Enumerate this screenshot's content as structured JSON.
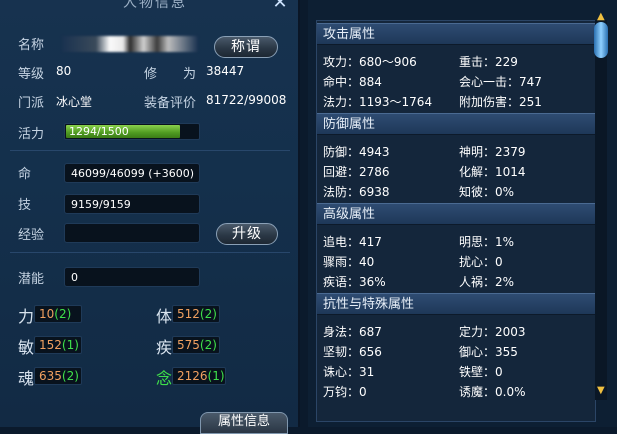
{
  "window": {
    "title": "人物信息",
    "close": "✕"
  },
  "profile": {
    "name_label": "名称",
    "title_button": "称谓",
    "level_label": "等级",
    "level_value": "80",
    "cultivation_label": "修　　为",
    "cultivation_value": "38447",
    "sect_label": "门派",
    "sect_value": "冰心堂",
    "rating_label": "装备评价",
    "rating_value": "81722/99008",
    "vitality_label": "活力",
    "vitality_value": "1294/1500",
    "vitality_fraction": 0.863,
    "life_label": "命",
    "life_value": "46099/46099 (+3600)",
    "skill_label": "技",
    "skill_value": "9159/9159",
    "exp_label": "经验",
    "exp_value": "",
    "upgrade_button": "升级",
    "potential_label": "潜能",
    "potential_value": "0"
  },
  "attributes": [
    {
      "label": "力",
      "base": "10",
      "plus": "(2)"
    },
    {
      "label": "体",
      "base": "512",
      "plus": "(2)"
    },
    {
      "label": "敏",
      "base": "152",
      "plus": "(1)"
    },
    {
      "label": "疾",
      "base": "575",
      "plus": "(2)"
    },
    {
      "label": "魂",
      "base": "635",
      "plus": "(2)"
    },
    {
      "label": "念",
      "base": "2126",
      "plus": "(1)"
    }
  ],
  "bottom_tab": "属性信息",
  "stats": {
    "attack": {
      "title": "攻击属性",
      "items": [
        "攻力：680～906",
        "重击：229",
        "命中：884",
        "会心一击：747",
        "法力：1193～1764",
        "附加伤害：251"
      ]
    },
    "defense": {
      "title": "防御属性",
      "items": [
        "防御：4943",
        "神明：2379",
        "回避：2786",
        "化解：1014",
        "法防：6938",
        "知彼：0%"
      ]
    },
    "advanced": {
      "title": "高级属性",
      "items": [
        "追电：417",
        "明思：1%",
        "骤雨：40",
        "扰心：0",
        "疾语：36%",
        "人祸：2%"
      ]
    },
    "resist": {
      "title": "抗性与特殊属性",
      "items": [
        "身法：687",
        "定力：2003",
        "坚韧：656",
        "御心：355",
        "诛心：31",
        "铁壁：0",
        "万钧：0",
        "诱魔：0.0%"
      ]
    }
  },
  "colors": {
    "accent_green": "#3fe04a",
    "base_orange": "#f0a060",
    "hp_green": "#5fae2a"
  }
}
